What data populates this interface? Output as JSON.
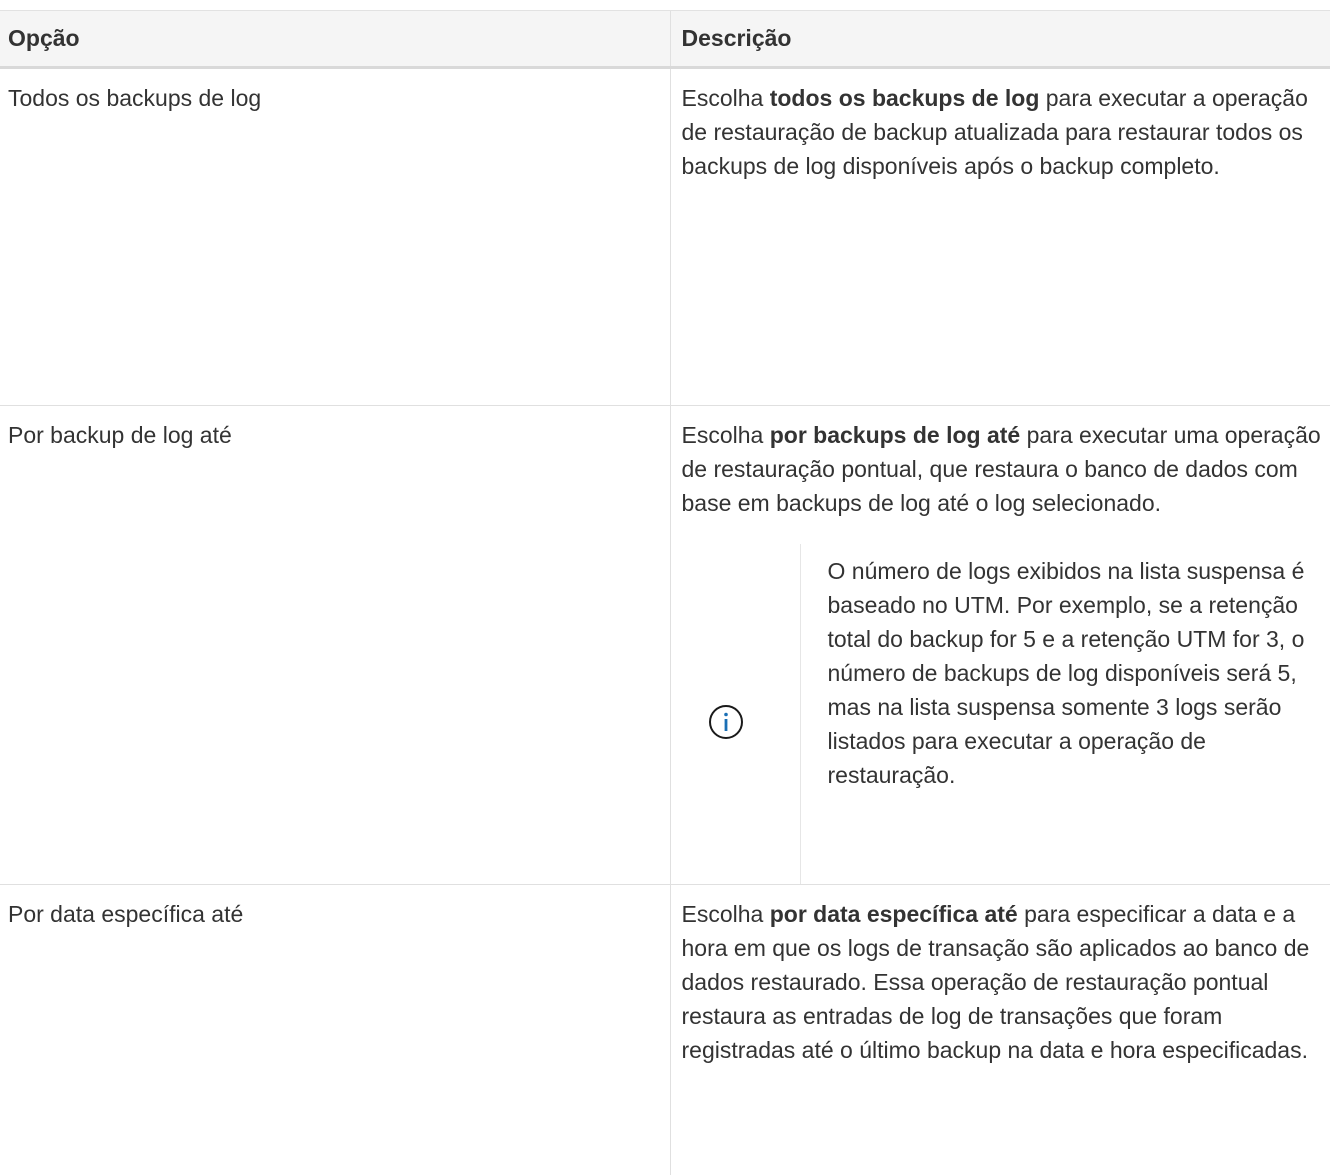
{
  "table": {
    "headers": [
      "Opção",
      "Descrição"
    ],
    "rows": [
      {
        "option": "Todos os backups de log",
        "desc_pre": "Escolha ",
        "desc_bold": "todos os backups de log",
        "desc_post": " para executar a operação de restauração de backup atualizada para restaurar todos os backups de log disponíveis após o backup completo."
      },
      {
        "option": "Por backup de log até",
        "desc_pre": "Escolha ",
        "desc_bold": "por backups de log até",
        "desc_post": " para executar uma operação de restauração pontual, que restaura o banco de dados com base em backups de log até o log selecionado.",
        "note": "O número de logs exibidos na lista suspensa é baseado no UTM. Por exemplo, se a retenção total do backup for 5 e a retenção UTM for 3, o número de backups de log disponíveis será 5, mas na lista suspensa somente 3 logs serão listados para executar a operação de restauração.",
        "note_icon": "info-circle-icon"
      },
      {
        "option": "Por data específica até",
        "desc_pre": "Escolha ",
        "desc_bold": "por data específica até",
        "desc_post": " para especificar a data e a hora em que os logs de transação são aplicados ao banco de dados restaurado. Essa operação de restauração pontual restaura as entradas de log de transações que foram registradas até o último backup na data e hora especificadas."
      }
    ]
  },
  "colors": {
    "text": "#333333",
    "header_bg": "#f5f5f5",
    "border": "#e0e0e0",
    "info_icon": "#1a6fb5"
  }
}
